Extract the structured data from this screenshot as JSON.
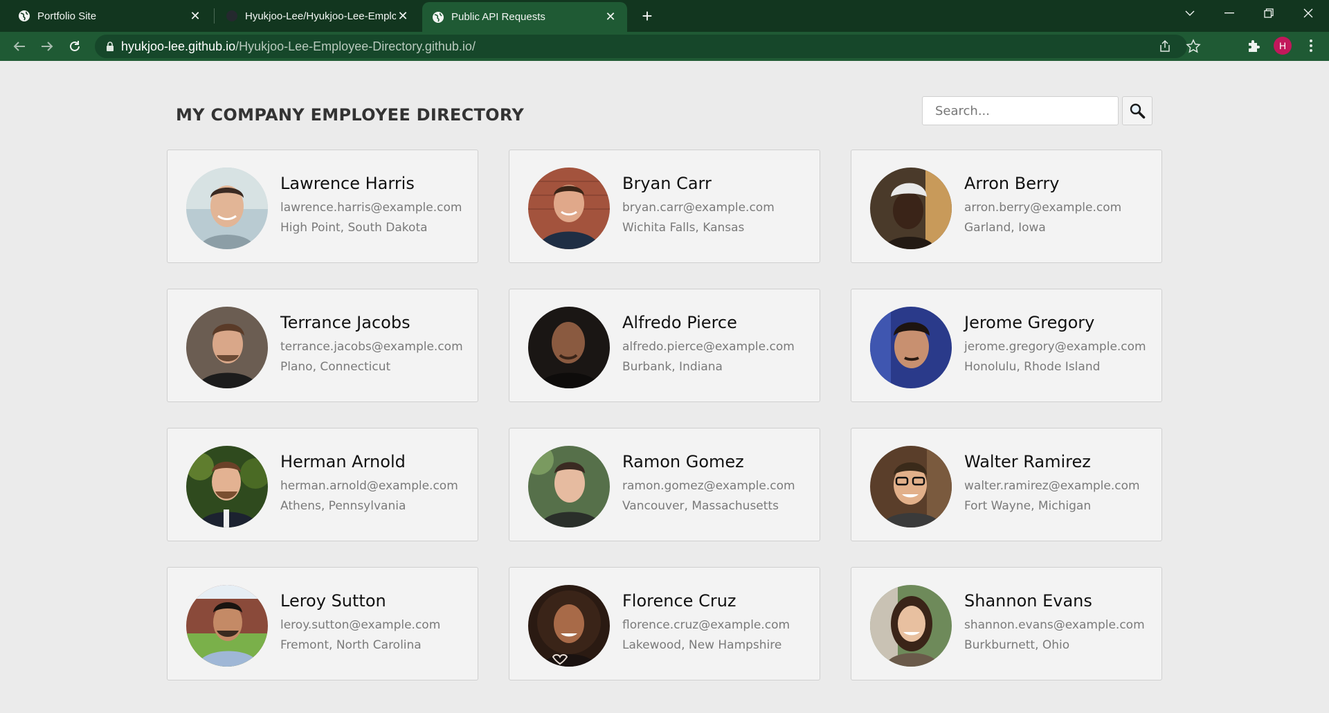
{
  "browser": {
    "tabs": [
      {
        "title": "Portfolio Site",
        "icon": "globe-icon"
      },
      {
        "title": "Hyukjoo-Lee/Hyukjoo-Lee-Emplc",
        "icon": "github-icon"
      },
      {
        "title": "Public API Requests",
        "icon": "globe-icon"
      }
    ],
    "active_tab_index": 2,
    "url_host": "hyukjoo-lee.github.io",
    "url_path": "/Hyukjoo-Lee-Employee-Directory.github.io/",
    "profile_initial": "H",
    "profile_color": "#c2185b",
    "theme_dark": "#12361f",
    "theme_toolbar": "#1f5a34"
  },
  "page": {
    "title": "MY COMPANY EMPLOYEE DIRECTORY",
    "search_placeholder": "Search...",
    "search_icon": "magnifier-icon"
  },
  "employees": [
    {
      "name": "Lawrence Harris",
      "email": "lawrence.harris@example.com",
      "location": "High Point, South Dakota"
    },
    {
      "name": "Bryan Carr",
      "email": "bryan.carr@example.com",
      "location": "Wichita Falls, Kansas"
    },
    {
      "name": "Arron Berry",
      "email": "arron.berry@example.com",
      "location": "Garland, Iowa"
    },
    {
      "name": "Terrance Jacobs",
      "email": "terrance.jacobs@example.com",
      "location": "Plano, Connecticut"
    },
    {
      "name": "Alfredo Pierce",
      "email": "alfredo.pierce@example.com",
      "location": "Burbank, Indiana"
    },
    {
      "name": "Jerome Gregory",
      "email": "jerome.gregory@example.com",
      "location": "Honolulu, Rhode Island"
    },
    {
      "name": "Herman Arnold",
      "email": "herman.arnold@example.com",
      "location": "Athens, Pennsylvania"
    },
    {
      "name": "Ramon Gomez",
      "email": "ramon.gomez@example.com",
      "location": "Vancouver, Massachusetts"
    },
    {
      "name": "Walter Ramirez",
      "email": "walter.ramirez@example.com",
      "location": "Fort Wayne, Michigan"
    },
    {
      "name": "Leroy Sutton",
      "email": "leroy.sutton@example.com",
      "location": "Fremont, North Carolina"
    },
    {
      "name": "Florence Cruz",
      "email": "florence.cruz@example.com",
      "location": "Lakewood, New Hampshire"
    },
    {
      "name": "Shannon Evans",
      "email": "shannon.evans@example.com",
      "location": "Burkburnett, Ohio"
    }
  ]
}
